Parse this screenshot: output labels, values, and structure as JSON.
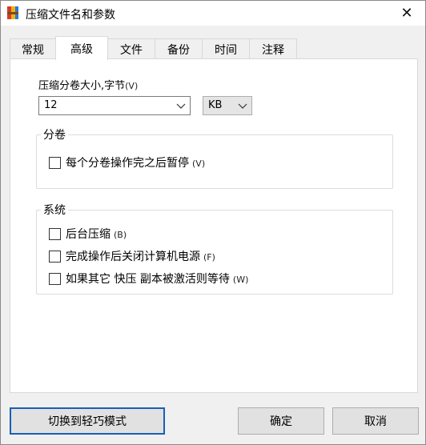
{
  "window": {
    "title": "压缩文件名和参数"
  },
  "tabs": [
    {
      "label": "常规"
    },
    {
      "label": "高级"
    },
    {
      "label": "文件"
    },
    {
      "label": "备份"
    },
    {
      "label": "时间"
    },
    {
      "label": "注释"
    }
  ],
  "active_tab": "高级",
  "volume": {
    "label": "压缩分卷大小,字节",
    "hotkey": "(V)",
    "value": "12",
    "unit": "KB"
  },
  "split_group": {
    "title": "分卷",
    "pause_label": "每个分卷操作完之后暂停",
    "pause_hotkey": "(V)",
    "pause_checked": false
  },
  "system_group": {
    "title": "系统",
    "options": [
      {
        "label": "后台压缩",
        "hotkey": "(B)",
        "checked": false
      },
      {
        "label": "完成操作后关闭计算机电源",
        "hotkey": "(F)",
        "checked": false
      },
      {
        "label": "如果其它 快压 副本被激活则等待",
        "hotkey": "(W)",
        "checked": false
      }
    ]
  },
  "buttons": {
    "simple_mode": "切换到轻巧模式",
    "ok": "确定",
    "cancel": "取消"
  }
}
